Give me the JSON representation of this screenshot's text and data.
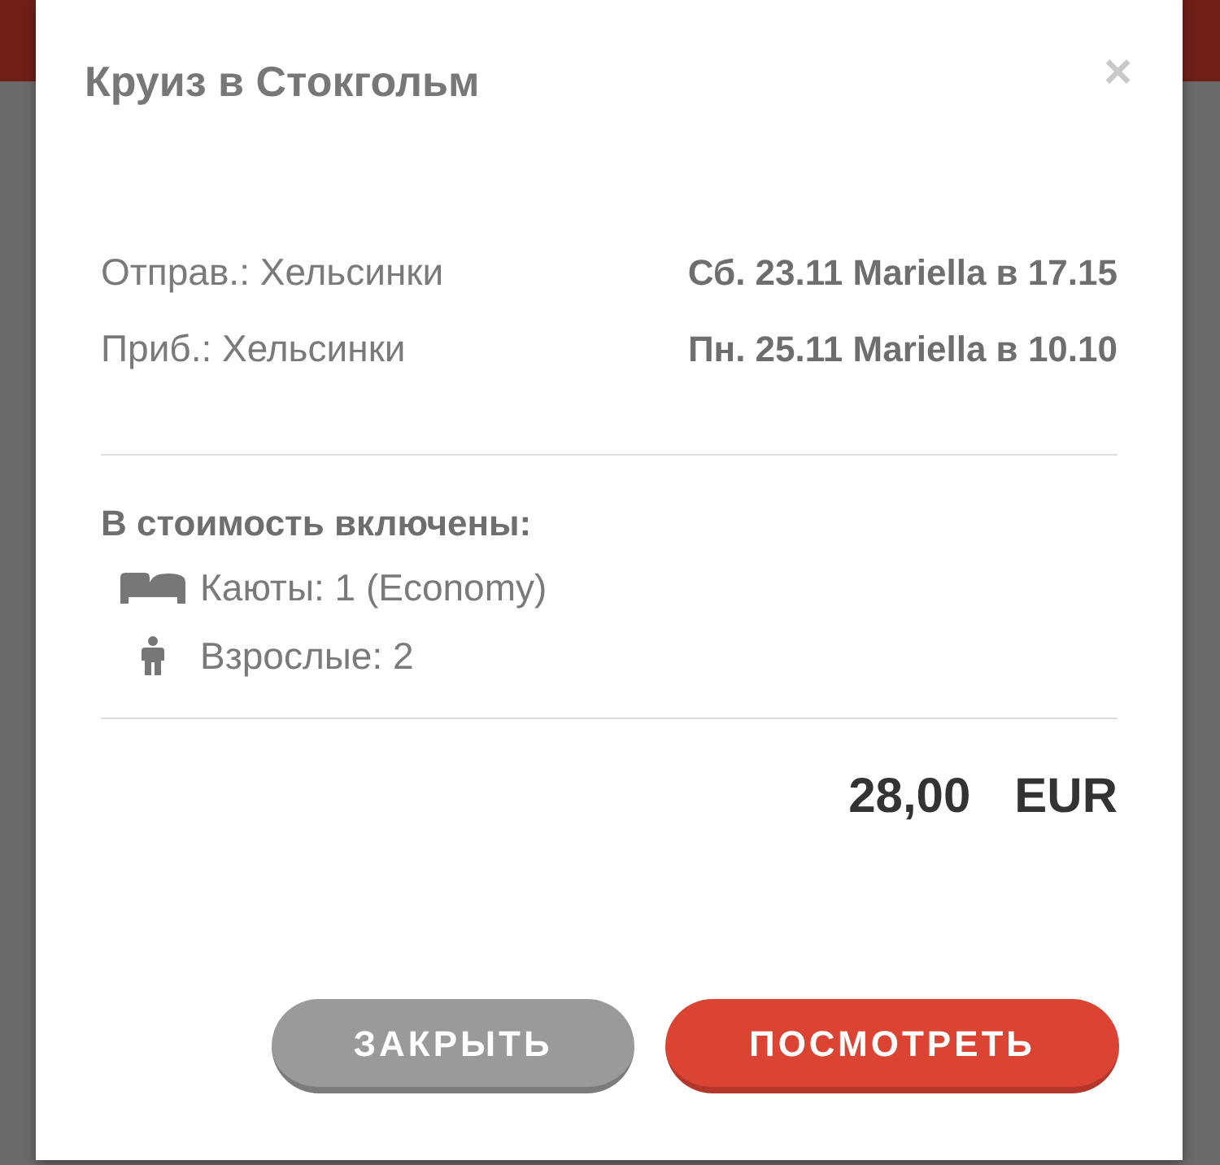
{
  "dialog": {
    "title": "Круиз в Стокгольм",
    "close": "×"
  },
  "trip": [
    {
      "label": "Отправ.: Хельсинки",
      "value": "Сб. 23.11 Mariella в 17.15"
    },
    {
      "label": "Приб.: Хельсинки",
      "value": "Пн. 25.11 Mariella в 10.10"
    }
  ],
  "included": {
    "heading": "В стоимость включены:",
    "items": [
      {
        "kind": "cabin",
        "text": "Каюты: 1 (Economy)"
      },
      {
        "kind": "adult",
        "text": "Взрослые: 2"
      }
    ]
  },
  "price": {
    "amount": "28,00",
    "currency": "EUR"
  },
  "buttons": [
    {
      "kind": "secondary",
      "label": "ЗАКРЫТЬ"
    },
    {
      "kind": "primary",
      "label": "ПОСМОТРЕТЬ"
    }
  ]
}
